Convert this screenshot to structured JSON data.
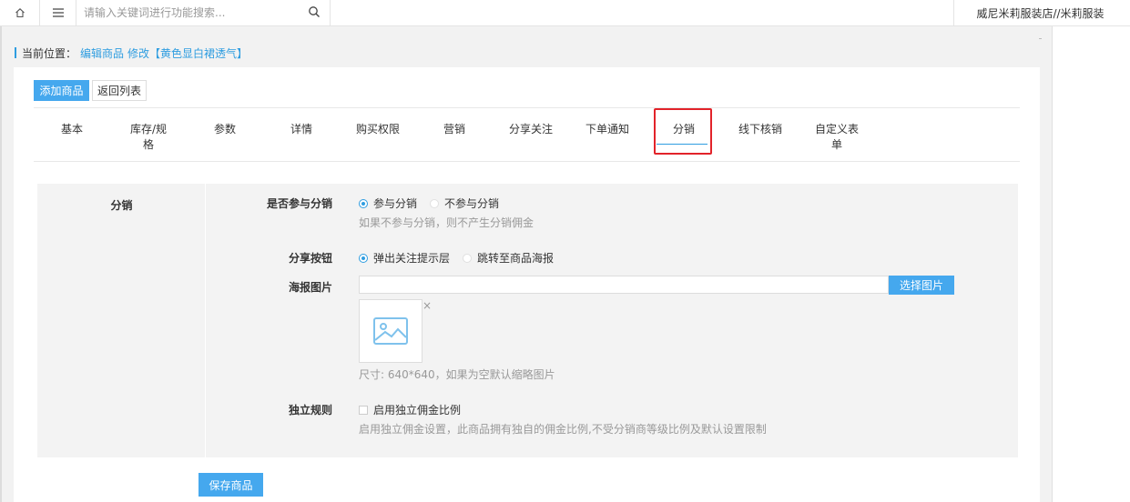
{
  "topbar": {
    "search_placeholder": "请输入关键词进行功能搜索...",
    "shop_name": "威尼米莉服装店//米莉服装"
  },
  "breadcrumb": {
    "label": "当前位置：",
    "item1": "编辑商品",
    "item2": "修改",
    "item3": "【黄色显白裙透气】"
  },
  "actions": {
    "add_label": "添加商品",
    "back_label": "返回列表"
  },
  "tabs": [
    {
      "label": "基本"
    },
    {
      "label": "库存/规\n格"
    },
    {
      "label": "参数"
    },
    {
      "label": "详情"
    },
    {
      "label": "购买权限"
    },
    {
      "label": "营销"
    },
    {
      "label": "分享关注"
    },
    {
      "label": "下单通知"
    },
    {
      "label": "分销",
      "active": true
    },
    {
      "label": "线下核销"
    },
    {
      "label": "自定义表\n单"
    }
  ],
  "section": {
    "title": "分销",
    "participate": {
      "label": "是否参与分销",
      "options": [
        "参与分销",
        "不参与分销"
      ],
      "selected": "参与分销",
      "hint": "如果不参与分销，则不产生分销佣金"
    },
    "share_button": {
      "label": "分享按钮",
      "options": [
        "弹出关注提示层",
        "跳转至商品海报"
      ],
      "selected": "弹出关注提示层"
    },
    "poster": {
      "label": "海报图片",
      "value": "",
      "choose_label": "选择图片",
      "size_hint": "尺寸: 640*640，如果为空默认缩略图片",
      "remove_glyph": "×"
    },
    "independent": {
      "label": "独立规则",
      "checkbox_label": "启用独立佣金比例",
      "checked": false,
      "hint": "启用独立佣金设置，此商品拥有独自的佣金比例,不受分销商等级比例及默认设置限制"
    }
  },
  "save_label": "保存商品",
  "colors": {
    "accent": "#45a8ee",
    "link": "#2f9de0",
    "highlight": "#e2232a"
  }
}
